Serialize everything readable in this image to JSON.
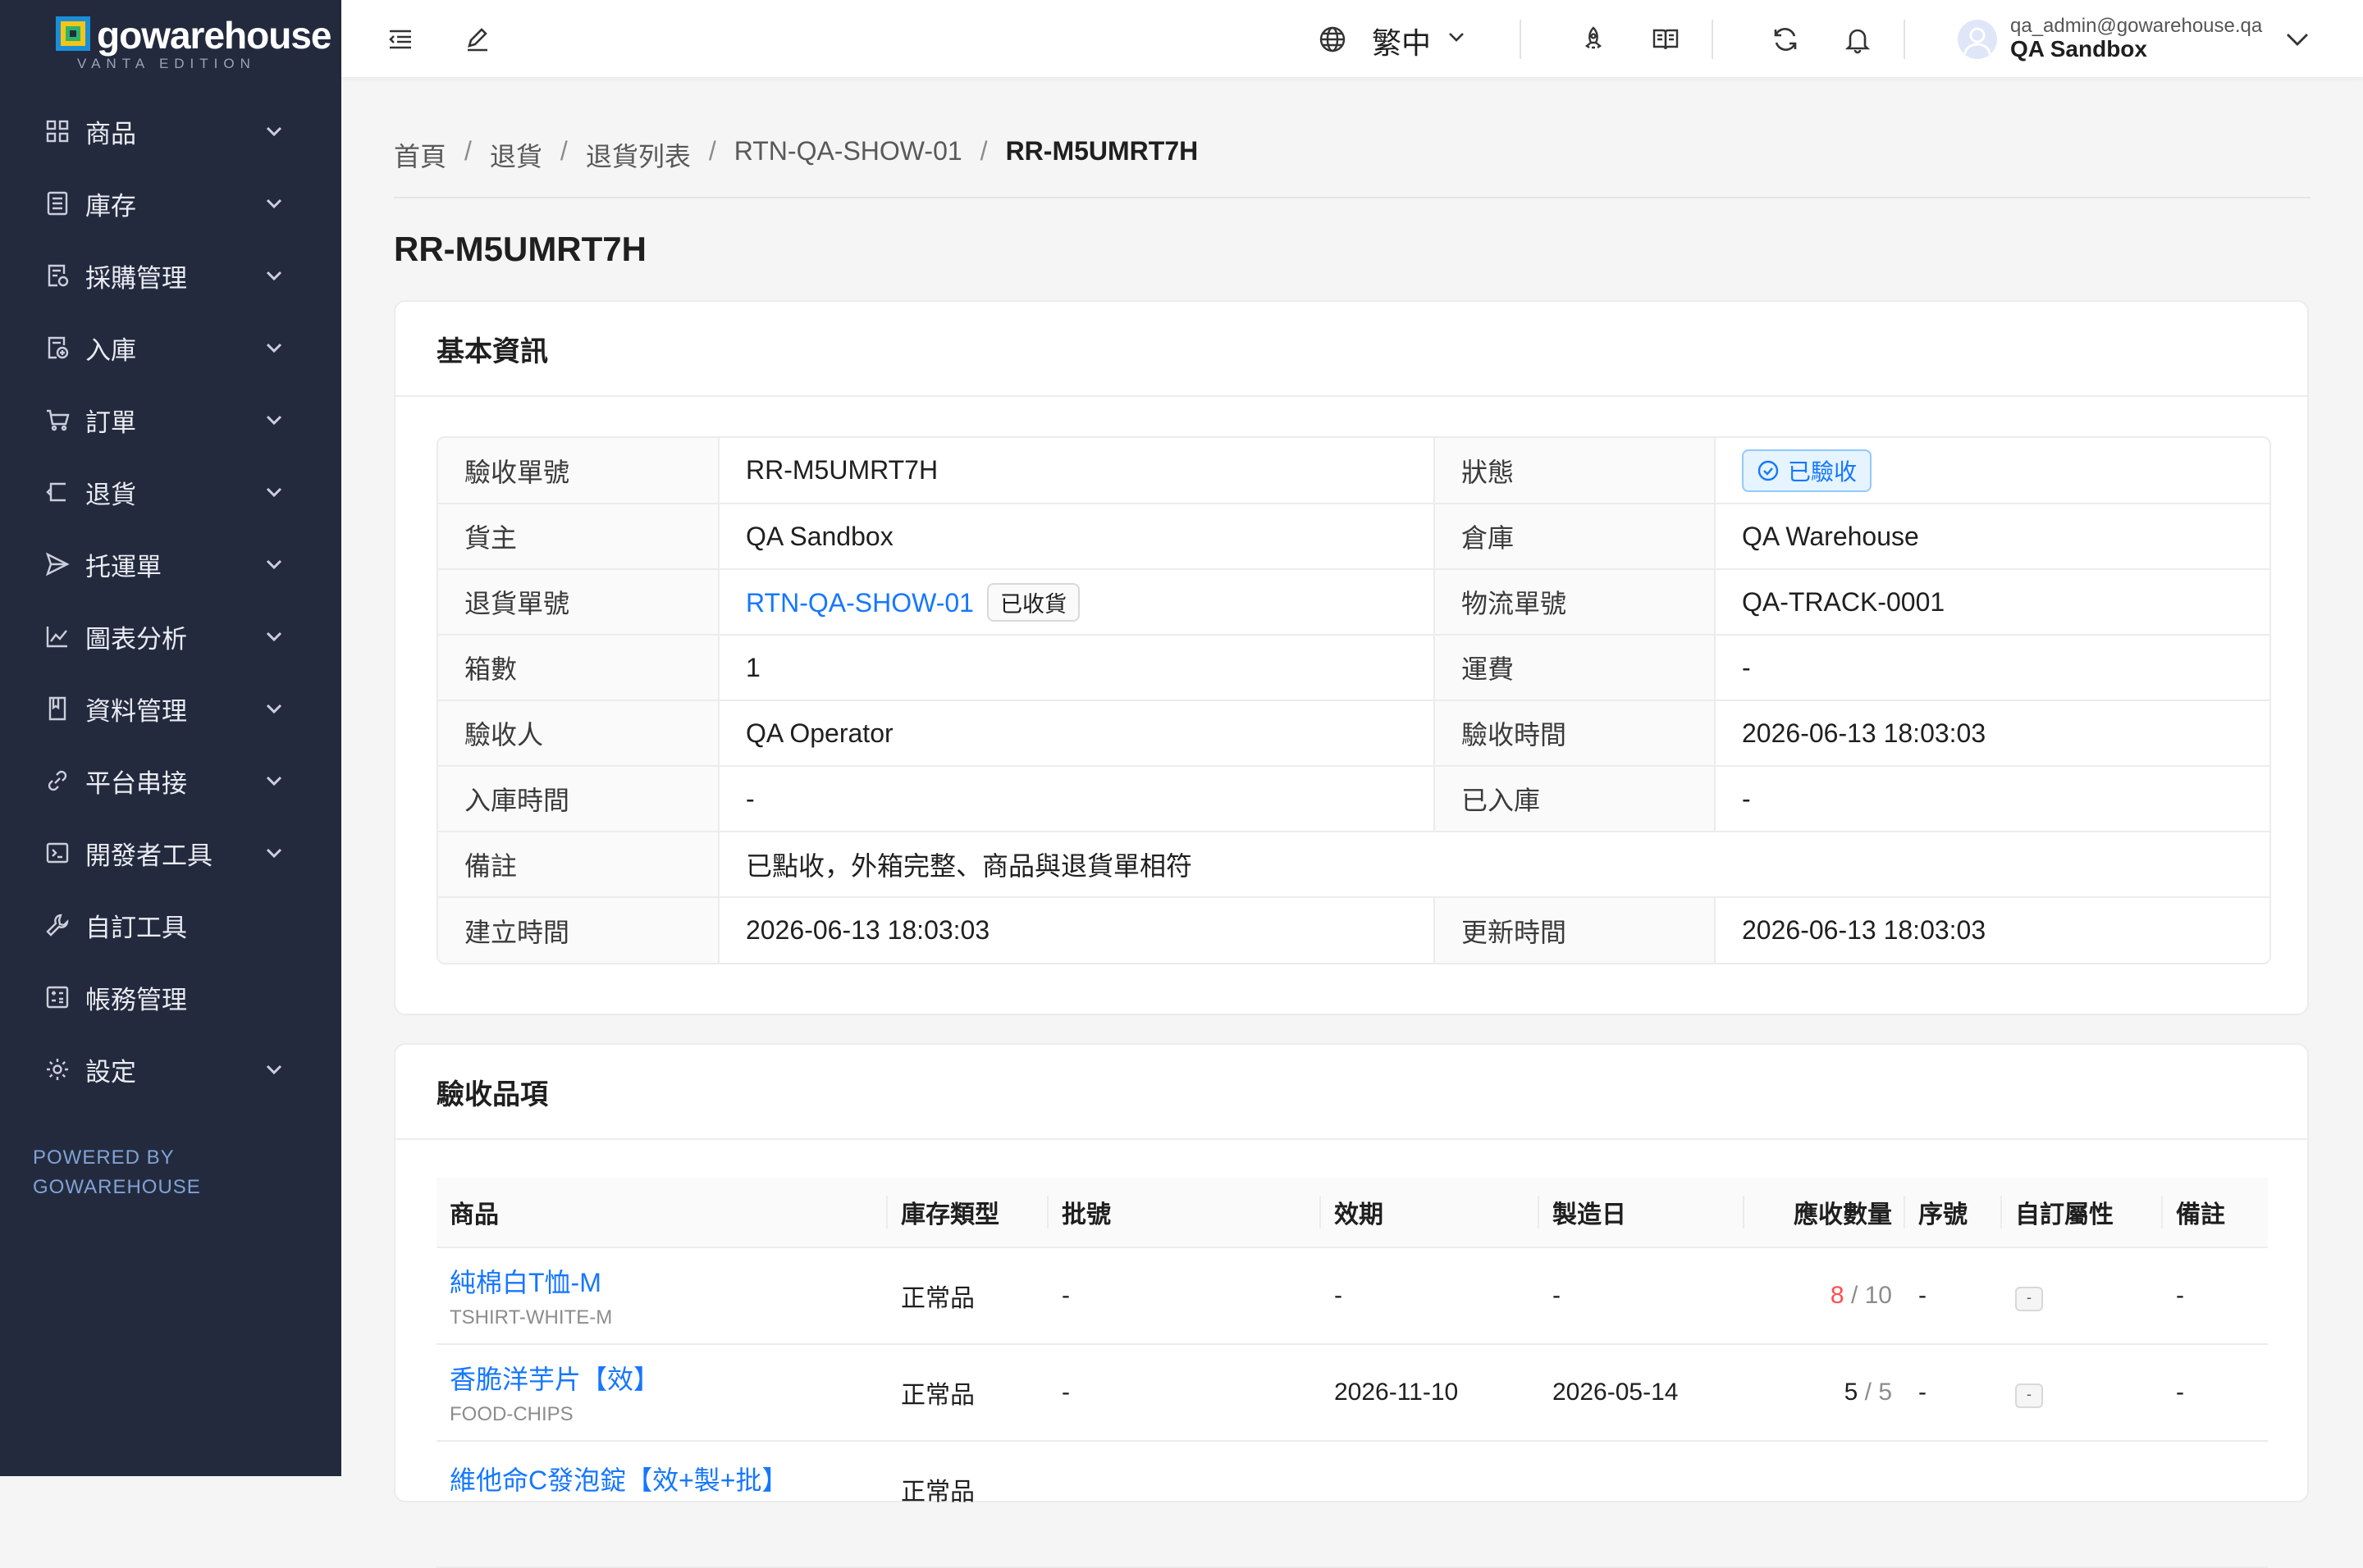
{
  "brand": {
    "name": "gowarehouse",
    "edition": "VANTA EDITION",
    "powered_by_line1": "POWERED BY",
    "powered_by_line2": "GOWAREHOUSE",
    "colors": {
      "sidebar_bg": "#242a3d",
      "accent": "#1677ff",
      "warn": "#ff4d4f"
    }
  },
  "sidebar": {
    "items": [
      {
        "label": "商品",
        "icon": "grid-icon",
        "expandable": true
      },
      {
        "label": "庫存",
        "icon": "inventory-icon",
        "expandable": true
      },
      {
        "label": "採購管理",
        "icon": "purchase-icon",
        "expandable": true
      },
      {
        "label": "入庫",
        "icon": "inbound-icon",
        "expandable": true
      },
      {
        "label": "訂單",
        "icon": "cart-icon",
        "expandable": true
      },
      {
        "label": "退貨",
        "icon": "return-icon",
        "expandable": true
      },
      {
        "label": "托運單",
        "icon": "send-icon",
        "expandable": true
      },
      {
        "label": "圖表分析",
        "icon": "chart-icon",
        "expandable": true
      },
      {
        "label": "資料管理",
        "icon": "book-icon",
        "expandable": true
      },
      {
        "label": "平台串接",
        "icon": "link-icon",
        "expandable": true
      },
      {
        "label": "開發者工具",
        "icon": "code-icon",
        "expandable": true
      },
      {
        "label": "自訂工具",
        "icon": "wrench-icon",
        "expandable": false
      },
      {
        "label": "帳務管理",
        "icon": "calculator-icon",
        "expandable": false
      },
      {
        "label": "設定",
        "icon": "gear-icon",
        "expandable": true
      }
    ]
  },
  "topbar": {
    "language": "繁中",
    "user_email": "qa_admin@gowarehouse.qa",
    "user_org": "QA Sandbox"
  },
  "breadcrumb": [
    "首頁",
    "退貨",
    "退貨列表",
    "RTN-QA-SHOW-01",
    "RR-M5UMRT7H"
  ],
  "page_title": "RR-M5UMRT7H",
  "basic_info": {
    "title": "基本資訊",
    "fields": {
      "receipt_no_label": "驗收單號",
      "receipt_no": "RR-M5UMRT7H",
      "status_label": "狀態",
      "status": "已驗收",
      "owner_label": "貨主",
      "owner": "QA Sandbox",
      "warehouse_label": "倉庫",
      "warehouse": "QA Warehouse",
      "return_no_label": "退貨單號",
      "return_no": "RTN-QA-SHOW-01",
      "return_status": "已收貨",
      "tracking_label": "物流單號",
      "tracking": "QA-TRACK-0001",
      "boxes_label": "箱數",
      "boxes": "1",
      "freight_label": "運費",
      "freight": "-",
      "inspector_label": "驗收人",
      "inspector": "QA Operator",
      "inspected_at_label": "驗收時間",
      "inspected_at": "2026-06-13 18:03:03",
      "stocked_at_label": "入庫時間",
      "stocked_at": "-",
      "stocked_label": "已入庫",
      "stocked": "-",
      "note_label": "備註",
      "note": "已點收，外箱完整、商品與退貨單相符",
      "created_label": "建立時間",
      "created": "2026-06-13 18:03:03",
      "updated_label": "更新時間",
      "updated": "2026-06-13 18:03:03"
    }
  },
  "items": {
    "title": "驗收品項",
    "columns": [
      "商品",
      "庫存類型",
      "批號",
      "效期",
      "製造日",
      "應收數量",
      "序號",
      "自訂屬性",
      "備註"
    ],
    "rows": [
      {
        "name": "純棉白T恤-M",
        "sku": "TSHIRT-WHITE-M",
        "stock_type": "正常品",
        "batch": "-",
        "expiry": "-",
        "mfg": "-",
        "received": "8",
        "expected": "10",
        "serial": "-",
        "attr": "-",
        "note": "-"
      },
      {
        "name": "香脆洋芋片【效】",
        "sku": "FOOD-CHIPS",
        "stock_type": "正常品",
        "batch": "-",
        "expiry": "2026-11-10",
        "mfg": "2026-05-14",
        "received": "5",
        "expected": "5",
        "serial": "-",
        "attr": "-",
        "note": "-"
      },
      {
        "name": "維他命C發泡錠【效+製+批】",
        "sku": "",
        "stock_type": "正常品",
        "batch": "",
        "expiry": "",
        "mfg": "",
        "received": "",
        "expected": "",
        "serial": "",
        "attr": "",
        "note": ""
      }
    ]
  }
}
